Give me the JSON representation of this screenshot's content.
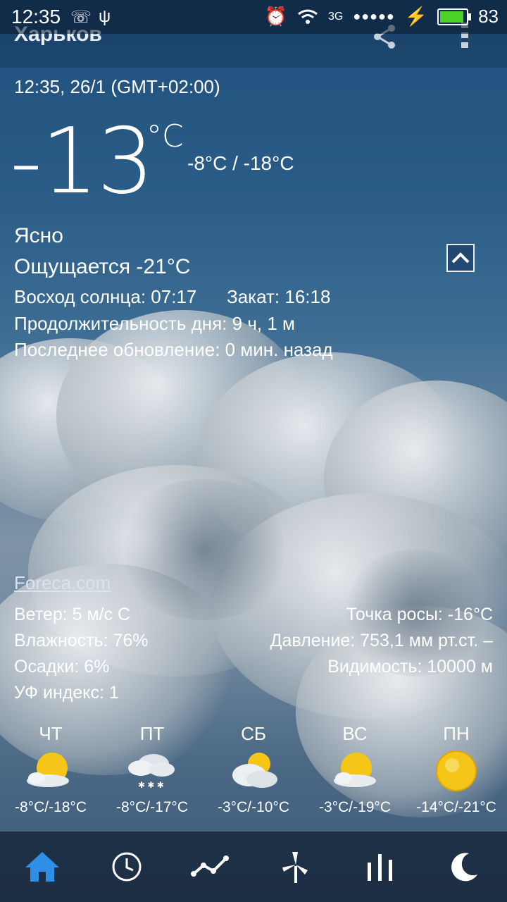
{
  "status_bar": {
    "time": "12:35",
    "network": "3G",
    "signal_dots": "●●●●●",
    "battery_level": "83"
  },
  "app_bar": {
    "city": "Харьков"
  },
  "current": {
    "datetime": "12:35, 26/1 (GMT+02:00)",
    "temperature": "-13",
    "unit": "°C",
    "range": "-8°C / -18°C",
    "condition": "Ясно",
    "feels_like": "Ощущается -21°C",
    "sunrise": "Восход солнца: 07:17",
    "sunset": "Закат: 16:18",
    "day_length": "Продолжительность дня: 9 ч, 1 м",
    "last_update": "Последнее обновление: 0 мин. назад"
  },
  "source": "Foreca.com",
  "details": {
    "wind": "Ветер: 5 м/с С",
    "humidity": "Влажность: 76%",
    "precipitation": "Осадки: 6%",
    "uv": "УФ индекс: 1",
    "dew_point": "Точка росы: -16°C",
    "pressure": "Давление: 753,1 мм рт.ст. –",
    "visibility": "Видимость: 10000 м"
  },
  "forecast": [
    {
      "day": "ЧТ",
      "range": "-8°C/-18°C",
      "icon": "partly-cloudy-sun-icon"
    },
    {
      "day": "ПТ",
      "range": "-8°C/-17°C",
      "icon": "snow-cloud-icon"
    },
    {
      "day": "СБ",
      "range": "-3°C/-10°C",
      "icon": "cloudy-sun-icon"
    },
    {
      "day": "ВС",
      "range": "-3°C/-19°C",
      "icon": "partly-cloudy-sun-icon"
    },
    {
      "day": "ПН",
      "range": "-14°C/-21°C",
      "icon": "sun-icon"
    }
  ],
  "nav": [
    "home-icon",
    "clock-icon",
    "graph-icon",
    "wind-turbine-icon",
    "bars-icon",
    "moon-icon"
  ],
  "colors": {
    "accent": "#2f8fe6",
    "battery": "#4cd32a",
    "sun": "#f5c518"
  }
}
